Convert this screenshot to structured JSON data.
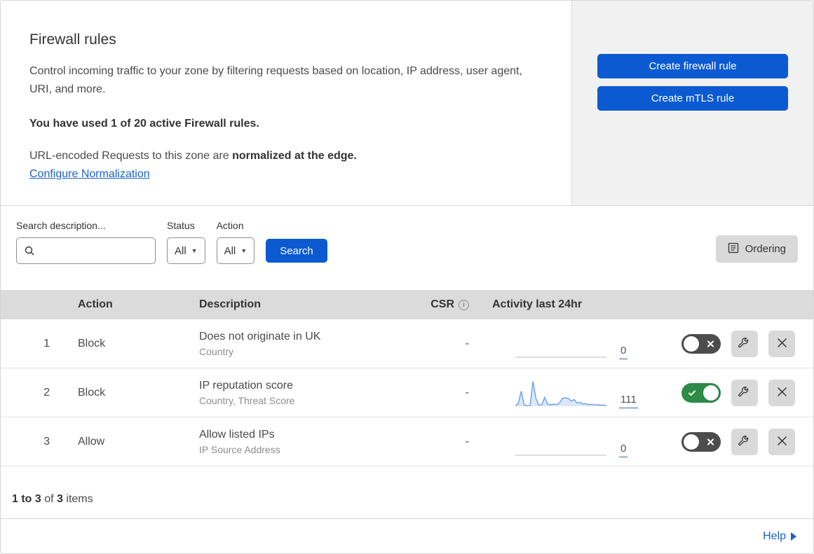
{
  "header": {
    "title": "Firewall rules",
    "description": "Control incoming traffic to your zone by filtering requests based on location, IP address, user agent, URI, and more.",
    "usage": "You have used 1 of 20 active Firewall rules.",
    "normalization_prefix": "URL-encoded Requests to this zone are ",
    "normalization_bold": "normalized at the edge.",
    "normalization_link": "Configure Normalization",
    "create_firewall_button": "Create firewall rule",
    "create_mtls_button": "Create mTLS rule"
  },
  "filters": {
    "search_label": "Search description...",
    "search_value": "",
    "status_label": "Status",
    "status_value": "All",
    "action_label": "Action",
    "action_value": "All",
    "search_button": "Search",
    "ordering_button": "Ordering"
  },
  "table": {
    "headers": {
      "action": "Action",
      "description": "Description",
      "csr": "CSR",
      "csr_info_icon": "i",
      "activity": "Activity last 24hr"
    },
    "rows": [
      {
        "num": "1",
        "action": "Block",
        "description": "Does not originate in UK",
        "fields": "Country",
        "csr": "-",
        "activity_count": "0",
        "enabled": false,
        "sparkline": null
      },
      {
        "num": "2",
        "action": "Block",
        "description": "IP reputation score",
        "fields": "Country, Threat Score",
        "csr": "-",
        "activity_count": "111",
        "enabled": true,
        "sparkline": [
          2,
          10,
          58,
          6,
          2,
          3,
          96,
          30,
          4,
          6,
          34,
          8,
          5,
          8,
          6,
          12,
          30,
          33,
          30,
          20,
          26,
          12,
          15,
          8,
          10,
          6,
          7,
          5,
          5,
          4,
          4,
          3
        ]
      },
      {
        "num": "3",
        "action": "Allow",
        "description": "Allow listed IPs",
        "fields": "IP Source Address",
        "csr": "-",
        "activity_count": "0",
        "enabled": false,
        "sparkline": null
      }
    ]
  },
  "footer": {
    "range": "1 to 3",
    "of": "of",
    "total": "3",
    "items": "items",
    "help_label": "Help"
  },
  "colors": {
    "primary_blue": "#0b5ad1",
    "link_blue": "#1b62c8",
    "toggle_on_green": "#2e8a47",
    "toggle_off_gray": "#4d4d4d",
    "header_gray": "#dbdbdb",
    "panel_gray": "#f1f1f1",
    "sparkline_blue": "#6d9ee3",
    "sparkline_fill": "#dce8f8"
  }
}
